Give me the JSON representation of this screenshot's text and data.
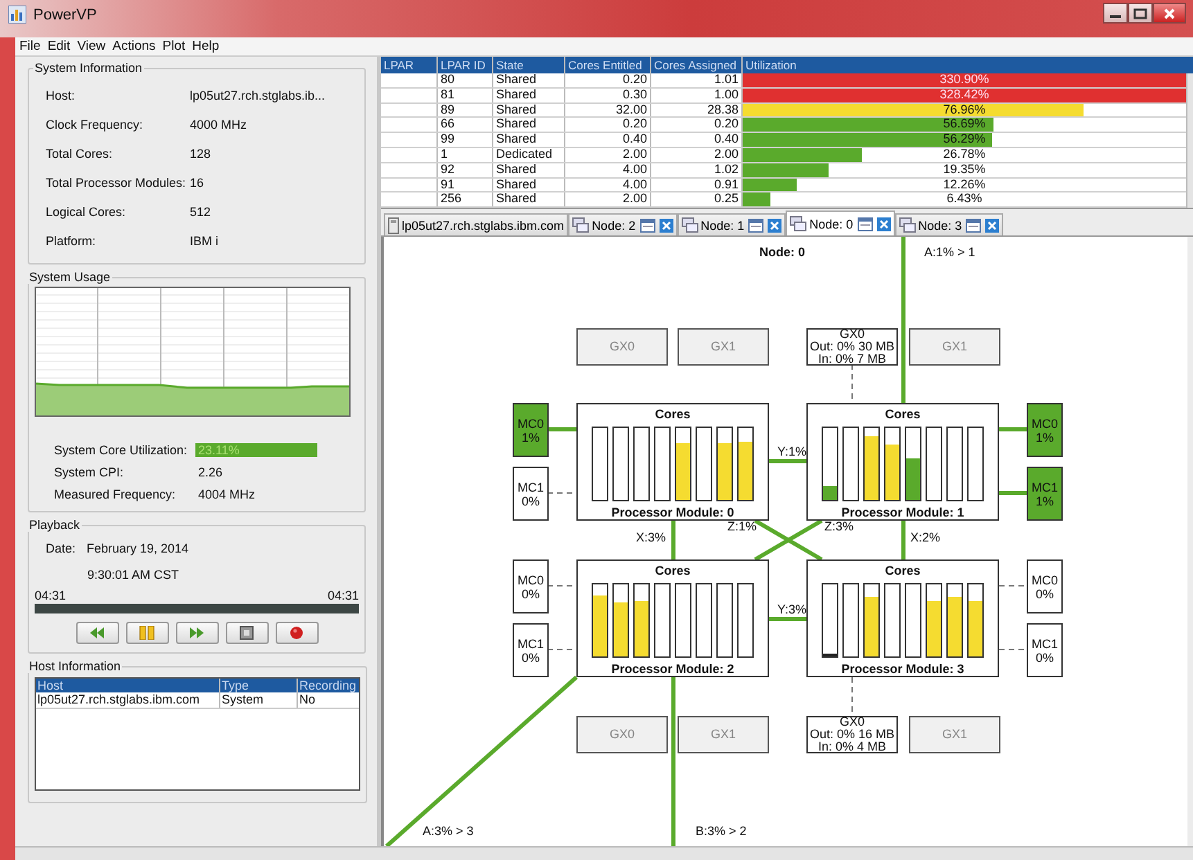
{
  "window": {
    "title": "PowerVP"
  },
  "menu": [
    "File",
    "Edit",
    "View",
    "Actions",
    "Plot",
    "Help"
  ],
  "system_information": {
    "title": "System Information",
    "fields": [
      {
        "label": "Host:",
        "value": "lp05ut27.rch.stglabs.ib..."
      },
      {
        "label": "Clock Frequency:",
        "value": "4000 MHz"
      },
      {
        "label": "Total Cores:",
        "value": "128"
      },
      {
        "label": "Total Processor Modules:",
        "value": "16"
      },
      {
        "label": "Logical Cores:",
        "value": "512"
      },
      {
        "label": "Platform:",
        "value": "IBM i"
      }
    ]
  },
  "system_usage": {
    "title": "System Usage",
    "fields": [
      {
        "label": "System Core Utilization:",
        "value": "23.11%",
        "kind": "bar"
      },
      {
        "label": "System CPI:",
        "value": "2.26",
        "kind": "text"
      },
      {
        "label": "Measured Frequency:",
        "value": "4004 MHz",
        "kind": "text"
      }
    ]
  },
  "playback": {
    "title": "Playback",
    "date_label": "Date:",
    "date": "February 19, 2014",
    "time": "9:30:01 AM CST",
    "start": "04:31",
    "end": "04:31",
    "buttons": [
      {
        "kind": "rewind"
      },
      {
        "kind": "pause"
      },
      {
        "kind": "forward"
      },
      {
        "kind": "stop"
      },
      {
        "kind": "record"
      }
    ]
  },
  "host_information": {
    "title": "Host Information",
    "columns": [
      "Host",
      "Type",
      "Recording"
    ],
    "rows": [
      {
        "cells": [
          "lp05ut27.rch.stglabs.ibm.com",
          "System",
          "No"
        ]
      }
    ]
  },
  "lpar_table": {
    "columns": [
      "LPAR",
      "LPAR ID",
      "State",
      "Cores Entitled",
      "Cores Assigned",
      "Utilization"
    ],
    "rows": [
      {
        "lpar_id": "80",
        "state": "Shared",
        "entitled": "0.20",
        "assigned": "1.01",
        "utilization": "330.90%",
        "level": 1,
        "color": "#e03030"
      },
      {
        "lpar_id": "81",
        "state": "Shared",
        "entitled": "0.30",
        "assigned": "1.00",
        "utilization": "328.42%",
        "level": 1,
        "color": "#e03030"
      },
      {
        "lpar_id": "89",
        "state": "Shared",
        "entitled": "32.00",
        "assigned": "28.38",
        "utilization": "76.96%",
        "level": 0.77,
        "color": "#f5dc30"
      },
      {
        "lpar_id": "66",
        "state": "Shared",
        "entitled": "0.20",
        "assigned": "0.20",
        "utilization": "56.69%",
        "level": 0.567,
        "color": "#5aaa2c"
      },
      {
        "lpar_id": "99",
        "state": "Shared",
        "entitled": "0.40",
        "assigned": "0.40",
        "utilization": "56.29%",
        "level": 0.563,
        "color": "#5aaa2c"
      },
      {
        "lpar_id": "1",
        "state": "Dedicated",
        "entitled": "2.00",
        "assigned": "2.00",
        "utilization": "26.78%",
        "level": 0.268,
        "color": "#5aaa2c"
      },
      {
        "lpar_id": "92",
        "state": "Shared",
        "entitled": "4.00",
        "assigned": "1.02",
        "utilization": "19.35%",
        "level": 0.194,
        "color": "#5aaa2c"
      },
      {
        "lpar_id": "91",
        "state": "Shared",
        "entitled": "4.00",
        "assigned": "0.91",
        "utilization": "12.26%",
        "level": 0.123,
        "color": "#5aaa2c"
      },
      {
        "lpar_id": "256",
        "state": "Shared",
        "entitled": "2.00",
        "assigned": "0.25",
        "utilization": "6.43%",
        "level": 0.064,
        "color": "#5aaa2c"
      }
    ]
  },
  "tabs": [
    {
      "label": "lp05ut27.rch.stglabs.ibm.com",
      "kind": "host",
      "selected": false
    },
    {
      "label": "Node: 2",
      "kind": "node",
      "selected": false
    },
    {
      "label": "Node: 1",
      "kind": "node",
      "selected": false
    },
    {
      "label": "Node: 0",
      "kind": "node",
      "selected": true
    },
    {
      "label": "Node: 3",
      "kind": "node",
      "selected": false
    }
  ],
  "node": {
    "title": "Node: 0",
    "gx_top": [
      {
        "label": "GX0",
        "disabled": true
      },
      {
        "label": "GX1",
        "disabled": true
      },
      {
        "label": "GX0",
        "disabled": false,
        "lines": [
          "Out: 0% 30 MB",
          "In: 0% 7 MB"
        ]
      },
      {
        "label": "GX1",
        "disabled": true
      }
    ],
    "gx_bottom": [
      {
        "label": "GX0",
        "disabled": true
      },
      {
        "label": "GX1",
        "disabled": true
      },
      {
        "label": "GX0",
        "disabled": false,
        "lines": [
          "Out: 0% 16 MB",
          "In: 0% 4 MB"
        ]
      },
      {
        "label": "GX1",
        "disabled": true
      }
    ],
    "modules": [
      {
        "cores_label": "Cores",
        "title": "Processor Module: 0",
        "cores": [
          {
            "idle": true
          },
          {
            "idle": true
          },
          {
            "idle": true
          },
          {
            "idle": true
          },
          {
            "idle": false,
            "level": 0.78,
            "color": "#f5dc30"
          },
          {
            "idle": true
          },
          {
            "idle": false,
            "level": 0.78,
            "color": "#f5dc30"
          },
          {
            "idle": false,
            "level": 0.8,
            "color": "#f5dc30"
          }
        ],
        "memory_controllers": [
          {
            "label": "MC0",
            "value": "1%",
            "active": true
          },
          {
            "label": "MC1",
            "value": "0%",
            "active": false
          }
        ]
      },
      {
        "cores_label": "Cores",
        "title": "Processor Module: 1",
        "cores": [
          {
            "idle": false,
            "level": 0.2,
            "color": "#5aaa2c"
          },
          {
            "idle": true
          },
          {
            "idle": false,
            "level": 0.88,
            "color": "#f5dc30"
          },
          {
            "idle": false,
            "level": 0.76,
            "color": "#f5dc30"
          },
          {
            "idle": false,
            "level": 0.57,
            "color": "#5aaa2c"
          },
          {
            "idle": true
          },
          {
            "idle": true
          },
          {
            "idle": true
          }
        ],
        "memory_controllers": [
          {
            "label": "MC0",
            "value": "1%",
            "active": true
          },
          {
            "label": "MC1",
            "value": "1%",
            "active": true
          }
        ]
      },
      {
        "cores_label": "Cores",
        "title": "Processor Module: 2",
        "cores": [
          {
            "idle": false,
            "level": 0.85,
            "color": "#f5dc30"
          },
          {
            "idle": false,
            "level": 0.75,
            "color": "#f5dc30"
          },
          {
            "idle": false,
            "level": 0.77,
            "color": "#f5dc30"
          },
          {
            "idle": true
          },
          {
            "idle": true
          },
          {
            "idle": true
          },
          {
            "idle": true
          },
          {
            "idle": true
          }
        ],
        "memory_controllers": [
          {
            "label": "MC0",
            "value": "0%",
            "active": false
          },
          {
            "label": "MC1",
            "value": "0%",
            "active": false
          }
        ]
      },
      {
        "cores_label": "Cores",
        "title": "Processor Module: 3",
        "cores": [
          {
            "idle": false,
            "level": 0.02,
            "color": "#222222"
          },
          {
            "idle": true
          },
          {
            "idle": false,
            "level": 0.83,
            "color": "#f5dc30"
          },
          {
            "idle": true
          },
          {
            "idle": true
          },
          {
            "idle": false,
            "level": 0.76,
            "color": "#f5dc30"
          },
          {
            "idle": false,
            "level": 0.83,
            "color": "#f5dc30"
          },
          {
            "idle": false,
            "level": 0.76,
            "color": "#f5dc30"
          }
        ],
        "memory_controllers": [
          {
            "label": "MC0",
            "value": "0%",
            "active": false
          },
          {
            "label": "MC1",
            "value": "0%",
            "active": false
          }
        ]
      }
    ],
    "links": [
      {
        "label": "A:1% > 1"
      },
      {
        "label": "Y:1%"
      },
      {
        "label": "X:3%"
      },
      {
        "label": "Z:1%"
      },
      {
        "label": "Z:3%"
      },
      {
        "label": "X:2%"
      },
      {
        "label": "Y:3%"
      },
      {
        "label": "A:3% > 3"
      },
      {
        "label": "B:3% > 2"
      }
    ]
  }
}
